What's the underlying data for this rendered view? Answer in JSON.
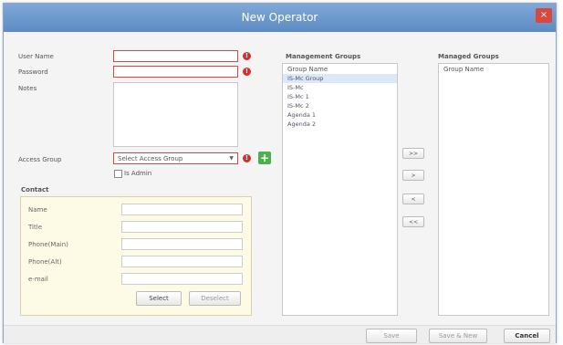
{
  "window": {
    "title": "New Operator",
    "close_label": "×"
  },
  "form": {
    "user_name_label": "User Name",
    "password_label": "Password",
    "notes_label": "Notes",
    "access_group_label": "Access Group",
    "access_group_value": "Select Access Group",
    "is_admin_label": "Is Admin",
    "error_glyph": "!",
    "add_glyph": "+"
  },
  "contact": {
    "heading": "Contact",
    "fields": [
      "Name",
      "Title",
      "Phone(Main)",
      "Phone(Alt)",
      "e-mail"
    ],
    "select_label": "Select",
    "deselect_label": "Deselect"
  },
  "management_groups": {
    "heading": "Management Groups",
    "column_header": "Group Name",
    "items": [
      "IS-Mc Group",
      "IS-Mc",
      "IS-Mc 1",
      "IS-Mc 2",
      "Agenda 1",
      "Agenda 2"
    ],
    "selected_index": 0
  },
  "managed_groups": {
    "heading": "Managed Groups",
    "column_header": "Group Name",
    "items": []
  },
  "transfer": {
    "add_all": ">>",
    "add": ">",
    "remove": "<",
    "remove_all": "<<"
  },
  "footer": {
    "save": "Save",
    "save_new": "Save & New",
    "cancel": "Cancel"
  }
}
